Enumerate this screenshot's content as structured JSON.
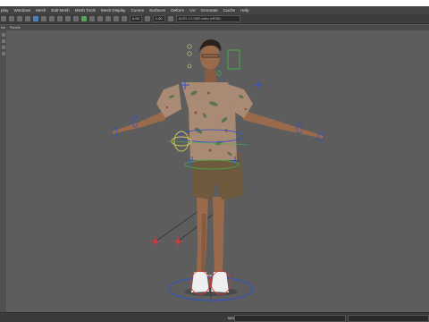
{
  "menu": {
    "items": [
      "play",
      "Windows",
      "Mesh",
      "Edit Mesh",
      "Mesh Tools",
      "Mesh Display",
      "Curves",
      "Surfaces",
      "Deform",
      "UV",
      "Generate",
      "Cache",
      "Help"
    ]
  },
  "toolbar": {
    "exposure": "0.00",
    "gamma": "1.00",
    "color_space": "ACES 1.0 SDR-video (sRGB)"
  },
  "panel_menu": {
    "items": [
      "ew",
      "Panels"
    ]
  },
  "viewport": {
    "camera_label": "persp",
    "background": "#5d5d5d"
  },
  "status": {
    "mel_label": "MEL"
  },
  "colors": {
    "menubar": "#444444",
    "toolbar": "#3d3d3d",
    "skin": "#9a6a4c",
    "shirt": "#a98a74",
    "shorts": "#6f5a3e",
    "control_blue": "#2f4fcf",
    "control_green": "#3fb54a",
    "control_red": "#d23b3b"
  }
}
